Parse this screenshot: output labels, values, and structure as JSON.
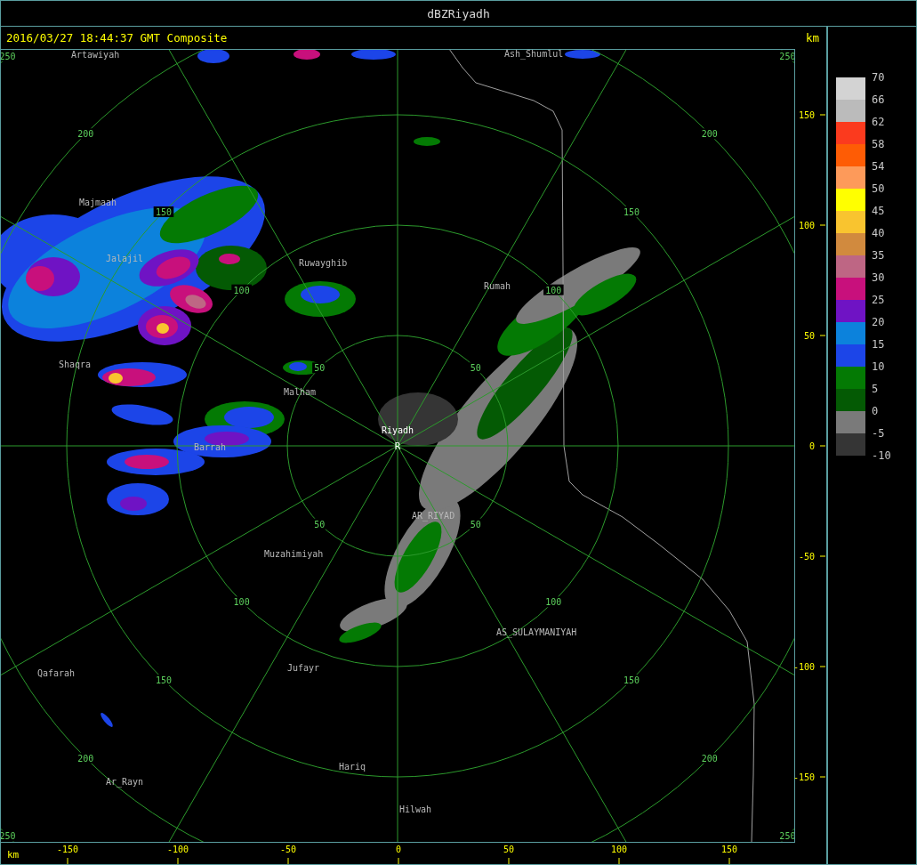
{
  "window": {
    "title": "dBZRiyadh"
  },
  "header": {
    "timestamp": "2016/03/27 18:44:37 GMT Composite",
    "unit": "km"
  },
  "radar": {
    "marker": "R"
  },
  "range_rings": [
    {
      "labels": [
        "50",
        "50",
        "50",
        "50"
      ]
    },
    {
      "labels": [
        "100",
        "100",
        "100",
        "100"
      ]
    },
    {
      "labels": [
        "150",
        "150",
        "150",
        "150"
      ]
    },
    {
      "labels": [
        "200",
        "200",
        "200",
        "200"
      ]
    },
    {
      "labels": [
        "250",
        "250",
        "250",
        "250"
      ]
    }
  ],
  "places": [
    {
      "name": "Artawiyah",
      "kind": "city"
    },
    {
      "name": "Ash_Shumlul",
      "kind": "city"
    },
    {
      "name": "Majmaah",
      "kind": "city"
    },
    {
      "name": "Jalajil",
      "kind": "city"
    },
    {
      "name": "Ruwayghib",
      "kind": "city"
    },
    {
      "name": "Rumah",
      "kind": "city"
    },
    {
      "name": "Shaqra",
      "kind": "city"
    },
    {
      "name": "Malham",
      "kind": "city"
    },
    {
      "name": "Riyadh",
      "kind": "site"
    },
    {
      "name": "Barrah",
      "kind": "city"
    },
    {
      "name": "AR_RIYAD",
      "kind": "city"
    },
    {
      "name": "Muzahimiyah",
      "kind": "city"
    },
    {
      "name": "AS_SULAYMANIYAH",
      "kind": "city"
    },
    {
      "name": "Jufayr",
      "kind": "city"
    },
    {
      "name": "Qafarah",
      "kind": "city"
    },
    {
      "name": "Hariq",
      "kind": "city"
    },
    {
      "name": "Ar_Rayn",
      "kind": "city"
    },
    {
      "name": "Hilwah",
      "kind": "city"
    }
  ],
  "x_axis": {
    "unit": "km",
    "ticks": [
      "-150",
      "-100",
      "-50",
      "0",
      "50",
      "100",
      "150"
    ]
  },
  "y_axis": {
    "ticks": [
      "150",
      "100",
      "50",
      "0",
      "-50",
      "-100",
      "-150"
    ]
  },
  "legend": {
    "bins": [
      {
        "label": "70",
        "color": "#d3d3d3"
      },
      {
        "label": "66",
        "color": "#bbbbbb"
      },
      {
        "label": "62",
        "color": "#fb3a1e"
      },
      {
        "label": "58",
        "color": "#fe5c05"
      },
      {
        "label": "54",
        "color": "#fd9a5a"
      },
      {
        "label": "50",
        "color": "#ffff00"
      },
      {
        "label": "45",
        "color": "#f9c42f"
      },
      {
        "label": "40",
        "color": "#d18a3e"
      },
      {
        "label": "35",
        "color": "#be6684"
      },
      {
        "label": "30",
        "color": "#c8107c"
      },
      {
        "label": "25",
        "color": "#6f13c4"
      },
      {
        "label": "20",
        "color": "#0c82dc"
      },
      {
        "label": "15",
        "color": "#1c45e8"
      },
      {
        "label": "10",
        "color": "#047a04"
      },
      {
        "label": "5",
        "color": "#045a04"
      },
      {
        "label": "0",
        "color": "#7a7a7a"
      },
      {
        "label": "-5",
        "color": "#353535"
      }
    ],
    "bottom_label": "-10"
  }
}
